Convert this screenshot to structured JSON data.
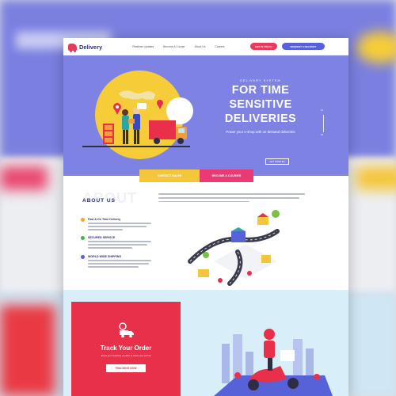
{
  "brand": {
    "name": "Delivery",
    "accent": "#e93a5c",
    "secondary": "#5862d8",
    "hero_bg": "#7d82e3",
    "yellow": "#f5c63a"
  },
  "nav": {
    "links": [
      "Realtime Updates",
      "Become A Courier",
      "About Us",
      "Careers"
    ],
    "get_in_touch": "GET IN TOUCH",
    "request": "REQUEST A DELIVERY"
  },
  "hero": {
    "subtitle": "DELIVERY SYSTEM",
    "title_line1": "FOR TIME",
    "title_line2": "SENSITIVE",
    "title_line3": "DELIVERIES",
    "tagline": "Power your e-shop with on-demand deliveries",
    "cta": "GET STARTED",
    "pager_top": "01",
    "pager_bottom": "03"
  },
  "tabs": {
    "sales": "CONTACT SALES",
    "courier": "BECOME A COURIER"
  },
  "about": {
    "ghost": "ABOUT",
    "title": "ABOUT US",
    "features": [
      {
        "title": "Fast & On Time Delivery",
        "icon": "clock-icon",
        "color": "#f5a623"
      },
      {
        "title": "SECURED SERVICE",
        "icon": "shield-icon",
        "color": "#4cb04a"
      },
      {
        "title": "WORLD WIDE SHIPPING",
        "icon": "globe-icon",
        "color": "#5862d8"
      }
    ]
  },
  "track": {
    "title": "Track Your Order",
    "description": "Enter your tracking number to track your parcel",
    "button": "TRACKING NOW"
  }
}
